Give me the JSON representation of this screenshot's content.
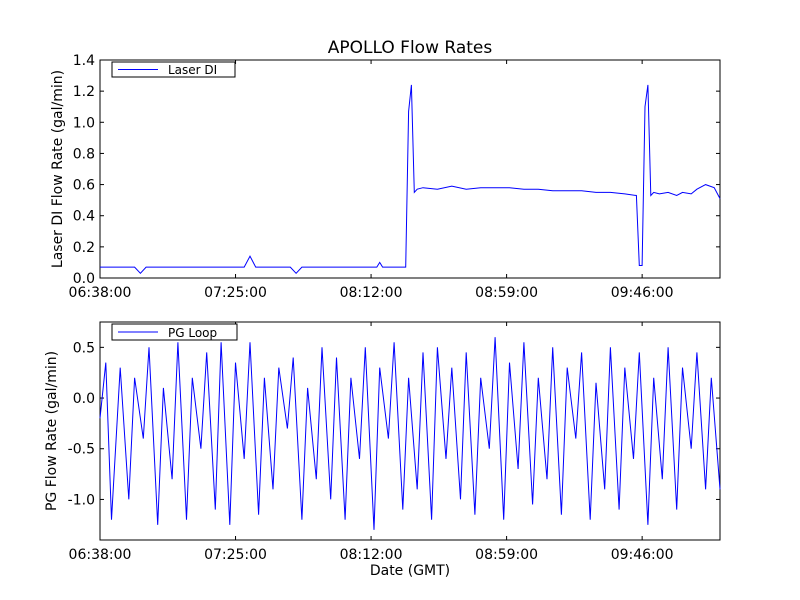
{
  "figure": {
    "title": "APOLLO Flow Rates",
    "colors": {
      "line": "#0000ff",
      "axes": "#000000",
      "background": "#ffffff"
    }
  },
  "chart_data": [
    {
      "type": "line",
      "ylabel": "Laser DI Flow Rate (gal/min)",
      "xlabel": "",
      "xlim": [
        "06:38:00",
        "10:13:00"
      ],
      "ylim": [
        0.0,
        1.4
      ],
      "xticks": [
        "06:38:00",
        "07:25:00",
        "08:12:00",
        "08:59:00",
        "09:46:00"
      ],
      "yticks": [
        "0.0",
        "0.2",
        "0.4",
        "0.6",
        "0.8",
        "1.0",
        "1.2",
        "1.4"
      ],
      "ytick_values": [
        0.0,
        0.2,
        0.4,
        0.6,
        0.8,
        1.0,
        1.2,
        1.4
      ],
      "legend_placement": "top-left",
      "grid": false,
      "series": [
        {
          "name": "Laser DI",
          "x": [
            "06:38:00",
            "06:45:00",
            "06:50:00",
            "06:52:00",
            "06:54:00",
            "07:00:00",
            "07:05:00",
            "07:10:00",
            "07:20:00",
            "07:28:00",
            "07:30:00",
            "07:32:00",
            "07:35:00",
            "07:40:00",
            "07:44:00",
            "07:46:00",
            "07:48:00",
            "07:55:00",
            "08:05:00",
            "08:14:00",
            "08:15:00",
            "08:16:00",
            "08:20:00",
            "08:24:00",
            "08:25:00",
            "08:26:00",
            "08:27:00",
            "08:28:00",
            "08:30:00",
            "08:35:00",
            "08:40:00",
            "08:45:00",
            "08:50:00",
            "08:55:00",
            "09:00:00",
            "09:05:00",
            "09:10:00",
            "09:15:00",
            "09:20:00",
            "09:25:00",
            "09:30:00",
            "09:35:00",
            "09:40:00",
            "09:44:00",
            "09:45:00",
            "09:46:00",
            "09:47:00",
            "09:48:00",
            "09:49:00",
            "09:50:00",
            "09:52:00",
            "09:55:00",
            "09:58:00",
            "10:00:00",
            "10:03:00",
            "10:05:00",
            "10:08:00",
            "10:11:00",
            "10:13:00"
          ],
          "y": [
            0.07,
            0.07,
            0.07,
            0.03,
            0.07,
            0.07,
            0.07,
            0.07,
            0.07,
            0.07,
            0.14,
            0.07,
            0.07,
            0.07,
            0.07,
            0.03,
            0.07,
            0.07,
            0.07,
            0.07,
            0.1,
            0.07,
            0.07,
            0.07,
            1.07,
            1.24,
            0.55,
            0.57,
            0.58,
            0.57,
            0.59,
            0.57,
            0.58,
            0.58,
            0.58,
            0.57,
            0.57,
            0.56,
            0.56,
            0.56,
            0.55,
            0.55,
            0.54,
            0.53,
            0.08,
            0.08,
            1.1,
            1.24,
            0.53,
            0.55,
            0.54,
            0.55,
            0.53,
            0.55,
            0.54,
            0.57,
            0.6,
            0.58,
            0.51
          ]
        }
      ]
    },
    {
      "type": "line",
      "ylabel": "PG Flow Rate (gal/min)",
      "xlabel": "Date (GMT)",
      "xlim": [
        "06:38:00",
        "10:13:00"
      ],
      "ylim": [
        -1.4,
        0.75
      ],
      "xticks": [
        "06:38:00",
        "07:25:00",
        "08:12:00",
        "08:59:00",
        "09:46:00"
      ],
      "yticks": [
        "0.5",
        "0.0",
        "-0.5",
        "-1.0"
      ],
      "ytick_values": [
        0.5,
        0.0,
        -0.5,
        -1.0
      ],
      "legend_placement": "top-left",
      "grid": false,
      "series": [
        {
          "name": "PG Loop",
          "x": [
            "06:38:00",
            "06:40:00",
            "06:42:00",
            "06:45:00",
            "06:48:00",
            "06:50:00",
            "06:53:00",
            "06:55:00",
            "06:58:00",
            "07:00:00",
            "07:03:00",
            "07:05:00",
            "07:08:00",
            "07:10:00",
            "07:13:00",
            "07:15:00",
            "07:18:00",
            "07:20:00",
            "07:23:00",
            "07:25:00",
            "07:28:00",
            "07:30:00",
            "07:33:00",
            "07:35:00",
            "07:38:00",
            "07:40:00",
            "07:43:00",
            "07:45:00",
            "07:48:00",
            "07:50:00",
            "07:53:00",
            "07:55:00",
            "07:58:00",
            "08:00:00",
            "08:03:00",
            "08:05:00",
            "08:08:00",
            "08:10:00",
            "08:13:00",
            "08:15:00",
            "08:18:00",
            "08:20:00",
            "08:23:00",
            "08:25:00",
            "08:28:00",
            "08:30:00",
            "08:33:00",
            "08:35:00",
            "08:38:00",
            "08:40:00",
            "08:43:00",
            "08:45:00",
            "08:48:00",
            "08:50:00",
            "08:53:00",
            "08:55:00",
            "08:58:00",
            "09:00:00",
            "09:03:00",
            "09:05:00",
            "09:08:00",
            "09:10:00",
            "09:13:00",
            "09:15:00",
            "09:18:00",
            "09:20:00",
            "09:23:00",
            "09:25:00",
            "09:28:00",
            "09:30:00",
            "09:33:00",
            "09:35:00",
            "09:38:00",
            "09:40:00",
            "09:43:00",
            "09:45:00",
            "09:48:00",
            "09:50:00",
            "09:53:00",
            "09:55:00",
            "09:58:00",
            "10:00:00",
            "10:03:00",
            "10:05:00",
            "10:08:00",
            "10:10:00",
            "10:13:00"
          ],
          "y": [
            -0.2,
            0.35,
            -1.2,
            0.3,
            -1.0,
            0.2,
            -0.4,
            0.5,
            -1.25,
            0.1,
            -0.8,
            0.55,
            -1.2,
            0.2,
            -0.5,
            0.45,
            -1.1,
            0.55,
            -1.25,
            0.35,
            -0.6,
            0.55,
            -1.15,
            0.2,
            -0.9,
            0.3,
            -0.3,
            0.4,
            -1.2,
            0.1,
            -0.8,
            0.5,
            -1.0,
            0.4,
            -1.2,
            0.2,
            -0.6,
            0.5,
            -1.3,
            0.3,
            -0.4,
            0.55,
            -1.1,
            0.2,
            -0.9,
            0.45,
            -1.2,
            0.5,
            -0.6,
            0.3,
            -1.0,
            0.45,
            -1.15,
            0.2,
            -0.5,
            0.6,
            -1.2,
            0.35,
            -0.7,
            0.55,
            -1.05,
            0.2,
            -0.8,
            0.5,
            -1.15,
            0.3,
            -0.4,
            0.45,
            -1.2,
            0.15,
            -0.9,
            0.5,
            -1.1,
            0.3,
            -0.6,
            0.45,
            -1.25,
            0.2,
            -0.8,
            0.5,
            -1.1,
            0.3,
            -0.5,
            0.45,
            -0.9,
            0.2,
            -0.9
          ]
        }
      ]
    }
  ]
}
